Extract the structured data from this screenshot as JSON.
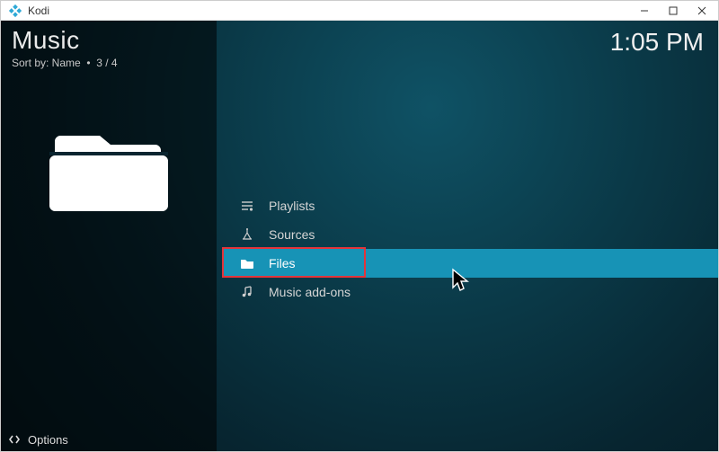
{
  "window": {
    "title": "Kodi"
  },
  "header": {
    "section_title": "Music",
    "sort_label": "Sort by: Name",
    "position": "3 / 4"
  },
  "clock": "1:05 PM",
  "menu": {
    "items": [
      {
        "icon": "playlist-icon",
        "label": "Playlists"
      },
      {
        "icon": "sources-icon",
        "label": "Sources"
      },
      {
        "icon": "folder-icon",
        "label": "Files"
      },
      {
        "icon": "music-note-icon",
        "label": "Music add-ons"
      }
    ],
    "selected_index": 2
  },
  "footer": {
    "options_label": "Options"
  }
}
